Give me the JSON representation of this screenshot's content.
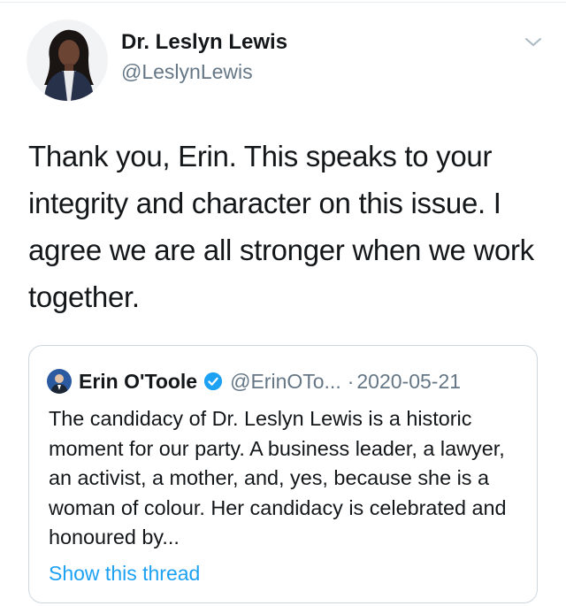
{
  "tweet": {
    "author": {
      "name": "Dr. Leslyn Lewis",
      "handle": "@LeslynLewis"
    },
    "text": "Thank you, Erin. This speaks to your integrity and character on this issue. I agree we are all stronger when we work together.",
    "menu_icon": "chevron-down-icon"
  },
  "quote": {
    "author": {
      "name": "Erin O'Toole",
      "verified": true,
      "handle": "@ErinOTo...",
      "separator": "·",
      "date": "2020-05-21"
    },
    "text": "The candidacy of Dr. Leslyn Lewis is a historic moment for our party. A business leader, a lawyer, an activist, a mother, and, yes, because she is a woman of colour. Her candidacy is celebrated and honoured by...",
    "show_thread_label": "Show this thread"
  },
  "colors": {
    "text_primary": "#14171a",
    "text_secondary": "#657786",
    "link": "#1da1f2",
    "border": "#ccd6dd",
    "verified_badge": "#1da1f2"
  }
}
